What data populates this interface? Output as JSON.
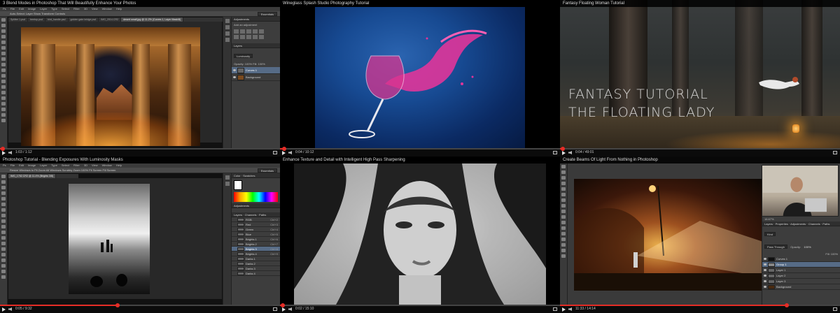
{
  "tiles": [
    {
      "title": "3 Blend Modes in Photoshop That Will Beautifully Enhance Your Photos",
      "time": "1:03 / 1:12",
      "progress": 0.01,
      "menu": [
        "Ps",
        "File",
        "Edit",
        "Image",
        "Layer",
        "Type",
        "Select",
        "Filter",
        "3D",
        "View",
        "Window",
        "Help"
      ],
      "options": "Auto-Select:  Layer    Show Transform Controls",
      "workspace": "Essentials",
      "doc_tabs": [
        "Splitter 1.psd",
        "treetop.psd",
        "bird_handle.psd",
        "golden gate bridge.psd",
        "IMG_2014.CR2",
        "desert small.jpg @ 11.2% (Curves 1, Layer Mask/8)"
      ],
      "panels": {
        "tab": "Adjustments",
        "sub": "Add an adjustment",
        "layers_tab": "Layers",
        "blend": "Luminosity",
        "opacity_label": "Opacity:",
        "opacity": "100%",
        "fill_label": "Fill:",
        "fill": "100%"
      },
      "layers": [
        {
          "name": "Curves 1",
          "selected": true
        },
        {
          "name": "Background",
          "selected": false
        }
      ]
    },
    {
      "title": "Wineglass Splash Studio Photography Tutorial",
      "time": "0:04 / 10:12",
      "progress": 0.015
    },
    {
      "title": "Fantasy Floating Woman Tutorial",
      "time": "0:04 / 49:01",
      "progress": 0.01,
      "overlay_lines": [
        "FANTASY TUTORIAL",
        "THE FLOATING LADY"
      ]
    },
    {
      "title": "Photoshop Tutorial - Blending Exposures With Luminosity Masks",
      "time": "0:05 / 9:32",
      "progress": 0.42,
      "menu": [
        "Ps",
        "File",
        "Edit",
        "Image",
        "Layer",
        "Type",
        "Select",
        "Filter",
        "3D",
        "View",
        "Window",
        "Help"
      ],
      "options": "Resize Windows to Fit    Zoom All Windows    Scrubby Zoom    100%    Fit Screen    Fill Screen",
      "workspace": "Essentials",
      "doc_tabs": [
        "IMG_1752.CR2 @ 11.4% (Brights 3/8)"
      ],
      "panels": {
        "tab": "Color",
        "swatches_tab": "Swatches",
        "adj_tab": "Adjustments",
        "layers_tab": "Layers",
        "channels_tab": "Channels",
        "paths_tab": "Paths"
      },
      "channels": [
        {
          "name": "RGB",
          "shortcut": "Ctrl+2"
        },
        {
          "name": "Red",
          "shortcut": "Ctrl+3"
        },
        {
          "name": "Green",
          "shortcut": "Ctrl+4"
        },
        {
          "name": "Blue",
          "shortcut": "Ctrl+5"
        },
        {
          "name": "Brights 1",
          "shortcut": "Ctrl+6"
        },
        {
          "name": "Brights 2",
          "shortcut": "Ctrl+7"
        },
        {
          "name": "Brights 3",
          "shortcut": "Ctrl+8"
        },
        {
          "name": "Brights 4",
          "shortcut": "Ctrl+9"
        },
        {
          "name": "Darks 1",
          "shortcut": ""
        },
        {
          "name": "Darks 2",
          "shortcut": ""
        },
        {
          "name": "Darks 3",
          "shortcut": ""
        },
        {
          "name": "Darks 4",
          "shortcut": ""
        }
      ]
    },
    {
      "title": "Enhance Texture and Detail with Intelligent High Pass Sharpening",
      "time": "0:02 / 15:10",
      "progress": 0.01
    },
    {
      "title": "Create Beams Of Light From Nothing in Photoshop",
      "time": "11:33 / 14:14",
      "progress": 0.81,
      "panels": {
        "layers_tab": "Layers",
        "properties_tab": "Properties",
        "adjust_tab": "Adjustments",
        "channels_tab": "Channels",
        "paths_tab": "Paths",
        "kind": "Kind",
        "blend": "Pass Through",
        "opacity_label": "Opacity:",
        "opacity": "100%",
        "fill_label": "Fill:",
        "fill": "100%",
        "zoom": "16.67%"
      },
      "layers": [
        {
          "name": "Curves 1",
          "selected": false
        },
        {
          "name": "Group 1",
          "selected": true
        },
        {
          "name": "Layer 1",
          "selected": false
        },
        {
          "name": "Layer 2",
          "selected": false
        },
        {
          "name": "Layer 3",
          "selected": false
        },
        {
          "name": "Background",
          "selected": false
        }
      ]
    }
  ],
  "colors": {
    "accent": "#e52d27",
    "ps_panel": "#3d3d3d",
    "ps_selected": "#566b86"
  }
}
